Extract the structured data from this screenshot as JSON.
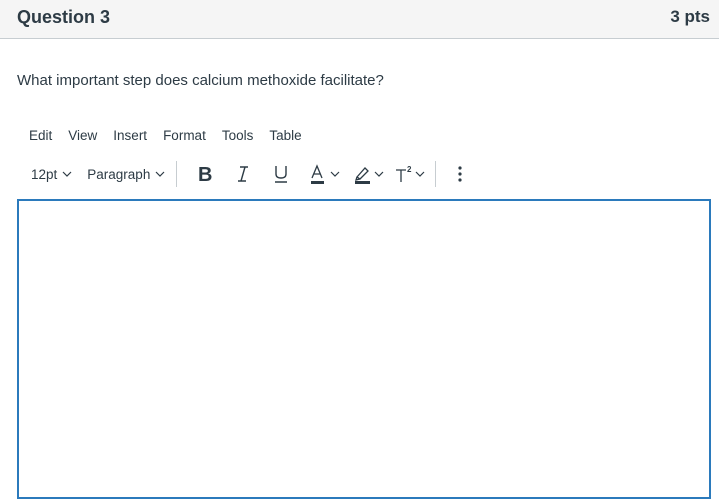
{
  "header": {
    "title": "Question 3",
    "points": "3 pts"
  },
  "question": {
    "text": "What important step does calcium methoxide facilitate?"
  },
  "menubar": {
    "items": [
      {
        "label": "Edit"
      },
      {
        "label": "View"
      },
      {
        "label": "Insert"
      },
      {
        "label": "Format"
      },
      {
        "label": "Tools"
      },
      {
        "label": "Table"
      }
    ]
  },
  "toolbar": {
    "font_size": "12pt",
    "block_format": "Paragraph",
    "icons": [
      "bold-icon",
      "italic-icon",
      "underline-icon",
      "text-color-icon",
      "highlight-color-icon",
      "superscript-icon",
      "more-vertical-icon"
    ],
    "accent_color": "#2b7abc",
    "text_color": "#2d3b45"
  },
  "editor": {
    "content": ""
  }
}
